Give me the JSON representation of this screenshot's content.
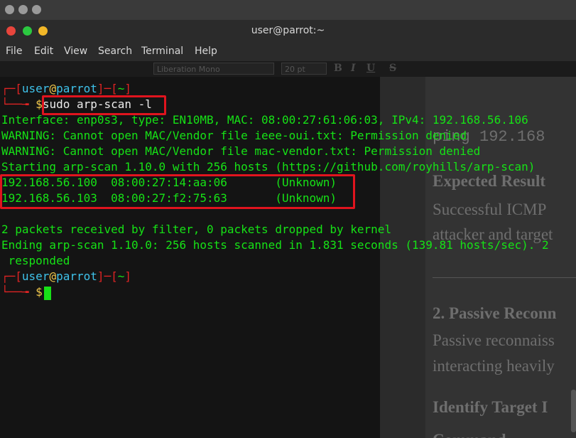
{
  "window": {
    "title": "user@parrot:~",
    "traffic_lights": {
      "close": "#e8453c",
      "minimize": "#2bc840",
      "maximize": "#f2b728"
    }
  },
  "menu": [
    "File",
    "Edit",
    "View",
    "Search",
    "Terminal",
    "Help"
  ],
  "background_app": {
    "toolbar": {
      "font_name": "Liberation Mono",
      "font_size": "20 pt",
      "format_glyphs": [
        "B",
        "I",
        "U",
        "S"
      ]
    },
    "document_fragments": [
      "ping 192.168",
      "Expected Result",
      "Successful ICMP",
      "attacker and target",
      "2. Passive Reconn",
      "Passive reconnaiss",
      "interacting heavily",
      "Identify Target I",
      "Command"
    ]
  },
  "prompt": {
    "corner_top": "┌─[",
    "user": "user",
    "at": "@",
    "host": "parrot",
    "mid": "]─[",
    "dir": "~",
    "close": "]",
    "corner_bottom": "└──╼ ",
    "dollar": "$"
  },
  "terminal": {
    "command": "sudo arp-scan -l",
    "output": [
      "Interface: enp0s3, type: EN10MB, MAC: 08:00:27:61:06:03, IPv4: 192.168.56.106",
      "WARNING: Cannot open MAC/Vendor file ieee-oui.txt: Permission denied",
      "WARNING: Cannot open MAC/Vendor file mac-vendor.txt: Permission denied",
      "Starting arp-scan 1.10.0 with 256 hosts (https://github.com/royhills/arp-scan)"
    ],
    "hosts": [
      {
        "ip": "192.168.56.100",
        "mac": "08:00:27:14:aa:06",
        "vendor": "(Unknown)"
      },
      {
        "ip": "192.168.56.103",
        "mac": "08:00:27:f2:75:63",
        "vendor": "(Unknown)"
      }
    ],
    "summary": [
      "2 packets received by filter, 0 packets dropped by kernel",
      "Ending arp-scan 1.10.0: 256 hosts scanned in 1.831 seconds (139.81 hosts/sec). 2",
      " responded"
    ]
  }
}
